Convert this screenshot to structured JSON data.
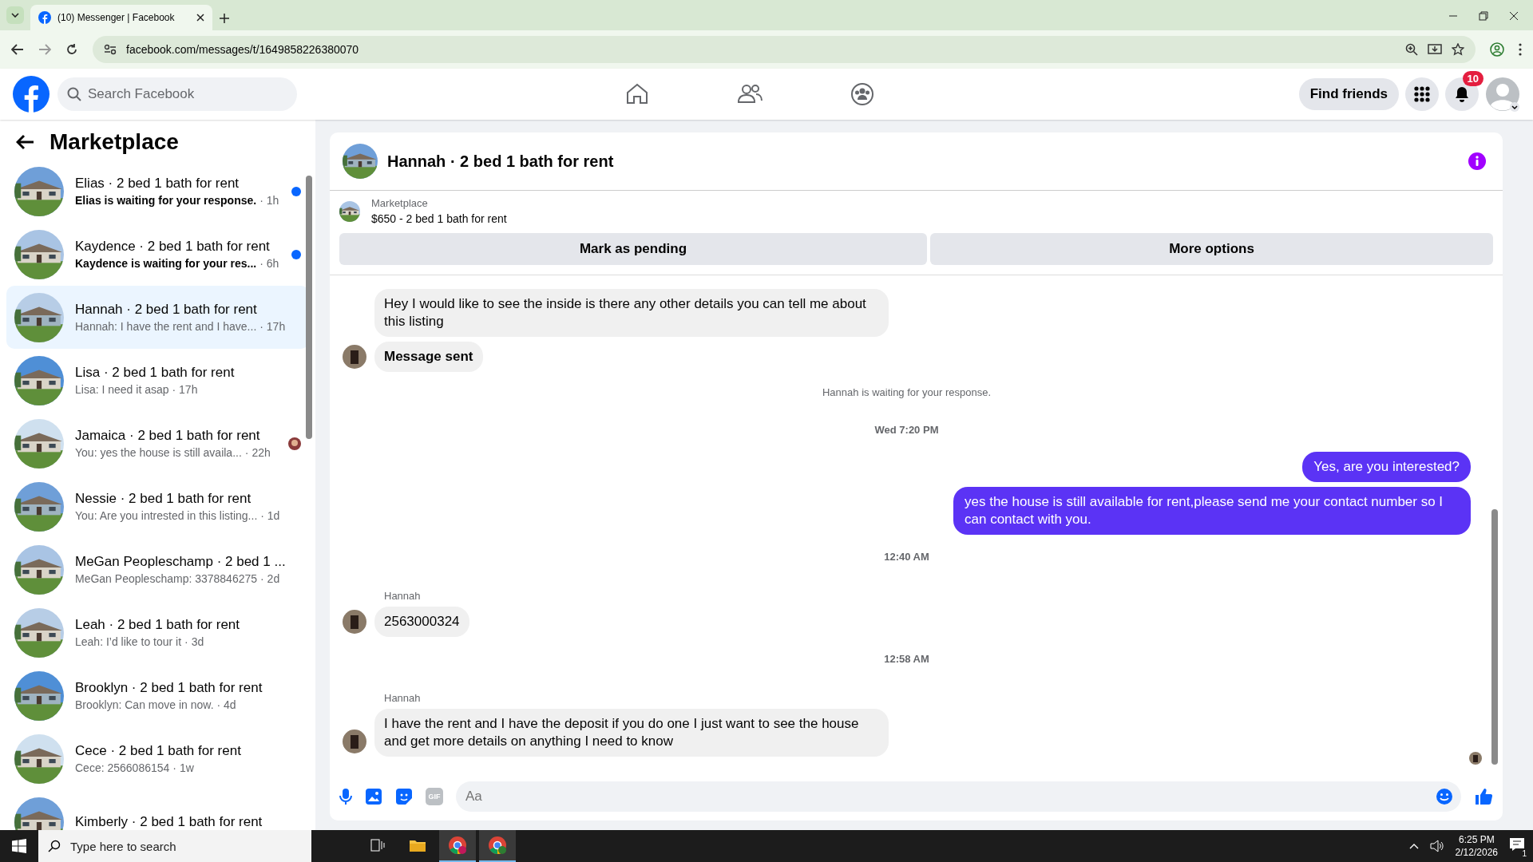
{
  "browser": {
    "tab_title": "(10) Messenger | Facebook",
    "url": "facebook.com/messages/t/1649858226380070"
  },
  "header": {
    "search": {
      "placeholder": "Search Facebook"
    },
    "find_friends": "Find friends",
    "notification_count": "10"
  },
  "sidebar": {
    "title": "Marketplace",
    "conversations": [
      {
        "title": "Elias · 2 bed 1 bath for rent",
        "preview": "Elias is waiting for your response.",
        "time": "· 1h",
        "unread": true,
        "selected": false,
        "seen": false
      },
      {
        "title": "Kaydence · 2 bed 1 bath for rent",
        "preview": "Kaydence is waiting for your res...",
        "time": "· 6h",
        "unread": true,
        "selected": false,
        "seen": false
      },
      {
        "title": "Hannah · 2 bed 1 bath for rent",
        "preview": "Hannah: I have the rent and I have...",
        "time": "· 17h",
        "unread": false,
        "selected": true,
        "seen": false
      },
      {
        "title": "Lisa · 2 bed 1 bath for rent",
        "preview": "Lisa: I need it asap",
        "time": "· 17h",
        "unread": false,
        "selected": false,
        "seen": false
      },
      {
        "title": "Jamaica · 2 bed 1 bath for rent",
        "preview": "You: yes the house is still availa...",
        "time": "· 22h",
        "unread": false,
        "selected": false,
        "seen": true
      },
      {
        "title": "Nessie · 2 bed 1 bath for rent",
        "preview": "You: Are you intrested in this listing...",
        "time": "· 1d",
        "unread": false,
        "selected": false,
        "seen": false
      },
      {
        "title": "MeGan Peopleschamp · 2 bed 1 ...",
        "preview": "MeGan Peopleschamp: 3378846275",
        "time": "· 2d",
        "unread": false,
        "selected": false,
        "seen": false
      },
      {
        "title": "Leah · 2 bed 1 bath for rent",
        "preview": "Leah: I’d like to tour it",
        "time": "· 3d",
        "unread": false,
        "selected": false,
        "seen": false
      },
      {
        "title": "Brooklyn · 2 bed 1 bath for rent",
        "preview": "Brooklyn: Can move in now.",
        "time": "· 4d",
        "unread": false,
        "selected": false,
        "seen": false
      },
      {
        "title": "Cece · 2 bed 1 bath for rent",
        "preview": "Cece: 2566086154",
        "time": "· 1w",
        "unread": false,
        "selected": false,
        "seen": false
      },
      {
        "title": "Kimberly · 2 bed 1 bath for rent",
        "unread": false,
        "selected": false,
        "seen": false
      }
    ]
  },
  "chat": {
    "title": "Hannah · 2 bed 1 bath for rent",
    "listing": {
      "source": "Marketplace",
      "summary": "$650 - 2 bed 1 bath for rent"
    },
    "actions": [
      "Mark as pending",
      "More options"
    ],
    "messages": [
      {
        "kind": "incoming",
        "text": "Hey I would like to see the inside is there any other details you can tell me about this listing",
        "avatar": false
      },
      {
        "kind": "status",
        "text": "Message sent",
        "avatar": true
      },
      {
        "kind": "notice",
        "text": "Hannah is waiting for your response."
      },
      {
        "kind": "time",
        "text": "Wed 7:20 PM"
      },
      {
        "kind": "outgoing",
        "text": "Yes, are you interested?"
      },
      {
        "kind": "outgoing",
        "text": "yes the house is still available for rent,please send me your contact number so I can contact with you."
      },
      {
        "kind": "time",
        "text": "12:40 AM"
      },
      {
        "kind": "incoming",
        "sender": "Hannah",
        "text": "2563000324",
        "avatar": true
      },
      {
        "kind": "time",
        "text": "12:58 AM"
      },
      {
        "kind": "incoming",
        "sender": "Hannah",
        "text": "I have the rent and I have the deposit if you do one I just want to see the house and get more details on anything I need to know",
        "avatar": true
      }
    ],
    "composer": {
      "placeholder": "Aa",
      "gif_label": "GIF"
    }
  },
  "taskbar": {
    "search_placeholder": "Type here to search",
    "time": "6:25 PM",
    "date": "2/12/2026",
    "notification_count": "1"
  }
}
